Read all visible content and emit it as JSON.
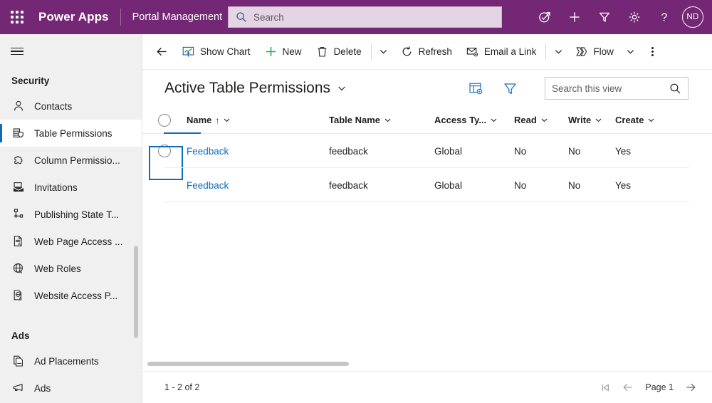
{
  "header": {
    "waffle_icon": "app-launcher-waffle-icon",
    "brand": "Power Apps",
    "app_name": "Portal Management",
    "search": {
      "placeholder": "Search",
      "value": "",
      "icon": "search-icon"
    },
    "icons": [
      {
        "name": "diagnostics-icon",
        "title": "Check access"
      },
      {
        "name": "plus-icon",
        "title": "New"
      },
      {
        "name": "filter-icon",
        "title": "Filter"
      },
      {
        "name": "gear-icon",
        "title": "Settings"
      },
      {
        "name": "help-icon",
        "title": "Help"
      }
    ],
    "avatar": {
      "initials": "ND"
    },
    "purple": "#742774"
  },
  "sidebar": {
    "hamburger_icon": "hamburger-menu-icon",
    "groups": [
      {
        "title": "Security",
        "items": [
          {
            "label": "Contacts",
            "icon": "contact-person-icon",
            "selected": false
          },
          {
            "label": "Table Permissions",
            "icon": "table-shield-icon",
            "selected": true
          },
          {
            "label": "Column Permissio...",
            "icon": "puzzle-piece-icon",
            "selected": false
          },
          {
            "label": "Invitations",
            "icon": "invitation-envelope-icon",
            "selected": false
          },
          {
            "label": "Publishing State T...",
            "icon": "state-transition-icon",
            "selected": false
          },
          {
            "label": "Web Page Access ...",
            "icon": "page-access-icon",
            "selected": false
          },
          {
            "label": "Web Roles",
            "icon": "globe-roles-icon",
            "selected": false
          },
          {
            "label": "Website Access P...",
            "icon": "website-access-icon",
            "selected": false
          }
        ]
      },
      {
        "title": "Ads",
        "items": [
          {
            "label": "Ad Placements",
            "icon": "ad-placements-icon",
            "selected": false
          },
          {
            "label": "Ads",
            "icon": "megaphone-icon",
            "selected": false
          }
        ]
      }
    ],
    "accent": "#0f6cbd"
  },
  "commandbar": {
    "back_icon": "back-arrow-icon",
    "buttons": [
      {
        "label": "Show Chart",
        "icon": "show-chart-icon"
      },
      {
        "label": "New",
        "icon": "plus-icon"
      },
      {
        "label": "Delete",
        "icon": "trash-delete-icon"
      }
    ],
    "delete_chevron_icon": "chevron-down-icon",
    "refresh": {
      "label": "Refresh",
      "icon": "refresh-icon"
    },
    "email_link": {
      "label": "Email a Link",
      "icon": "email-link-icon"
    },
    "email_chevron_icon": "chevron-down-icon",
    "flow": {
      "label": "Flow",
      "icon": "flow-icon"
    },
    "flow_chevron_icon": "chevron-down-icon",
    "overflow_icon": "more-vertical-icon"
  },
  "view": {
    "title": "Active Table Permissions",
    "title_chevron_icon": "chevron-down-icon",
    "edit_columns_icon": "edit-columns-icon",
    "edit_filters_icon": "edit-filters-icon",
    "search": {
      "placeholder": "Search this view",
      "value": "",
      "icon": "search-icon"
    }
  },
  "grid": {
    "select_all_icon": "select-all-circle-icon",
    "columns": [
      {
        "label": "Name",
        "sort": "↑",
        "chevron": "⌄"
      },
      {
        "label": "Table Name",
        "sort": "",
        "chevron": "⌄"
      },
      {
        "label": "Access Ty...",
        "sort": "",
        "chevron": "⌄"
      },
      {
        "label": "Read",
        "sort": "",
        "chevron": "⌄"
      },
      {
        "label": "Write",
        "sort": "",
        "chevron": "⌄"
      },
      {
        "label": "Create",
        "sort": "",
        "chevron": "⌄"
      }
    ],
    "rows": [
      {
        "name": "Feedback",
        "table_name": "feedback",
        "access_type": "Global",
        "read": "No",
        "write": "No",
        "create": "Yes",
        "focused": true
      },
      {
        "name": "Feedback",
        "table_name": "feedback",
        "access_type": "Global",
        "read": "No",
        "write": "No",
        "create": "Yes",
        "focused": false
      }
    ]
  },
  "footer": {
    "record_count": "1 - 2 of 2",
    "first_page_icon": "first-page-icon",
    "prev_page_icon": "previous-page-icon",
    "page_label": "Page 1",
    "next_page_icon": "next-page-icon"
  }
}
